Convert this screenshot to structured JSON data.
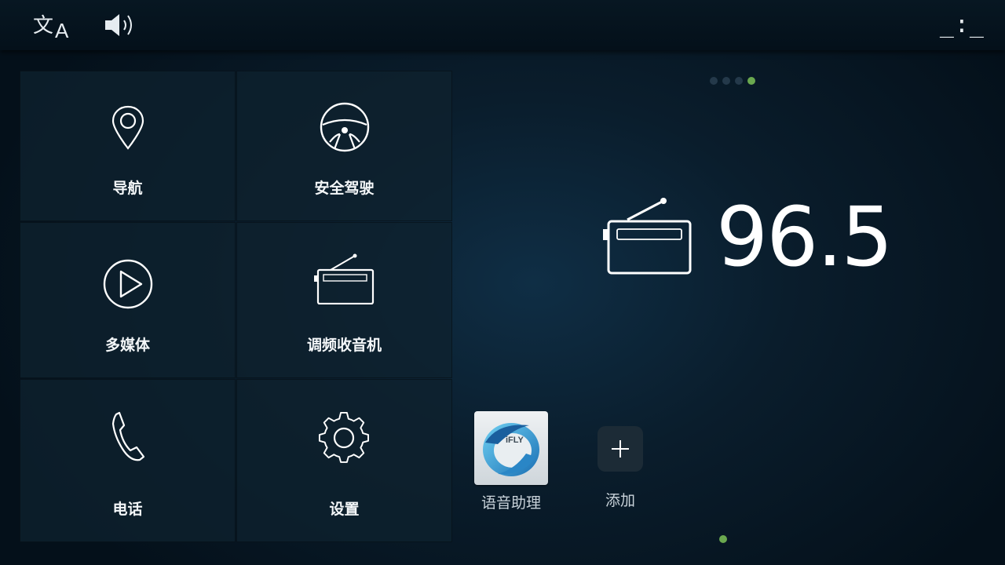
{
  "statusbar": {
    "language_icon_zh": "文",
    "language_icon_en": "A",
    "clock": "_:_"
  },
  "menu": {
    "items": [
      {
        "label": "导航",
        "icon": "location-pin-icon"
      },
      {
        "label": "安全驾驶",
        "icon": "steering-wheel-icon"
      },
      {
        "label": "多媒体",
        "icon": "play-icon"
      },
      {
        "label": "调频收音机",
        "icon": "radio-icon"
      },
      {
        "label": "电话",
        "icon": "phone-icon"
      },
      {
        "label": "设置",
        "icon": "gear-icon"
      }
    ]
  },
  "radio": {
    "frequency": "96.5"
  },
  "pager": {
    "top_pages": 4,
    "top_active": 4,
    "bottom_pages": 1,
    "active_color": "#6aa84f"
  },
  "apps": [
    {
      "label": "语音助理",
      "icon_text": "iFLY"
    },
    {
      "label": "添加",
      "icon": "plus-icon"
    }
  ]
}
